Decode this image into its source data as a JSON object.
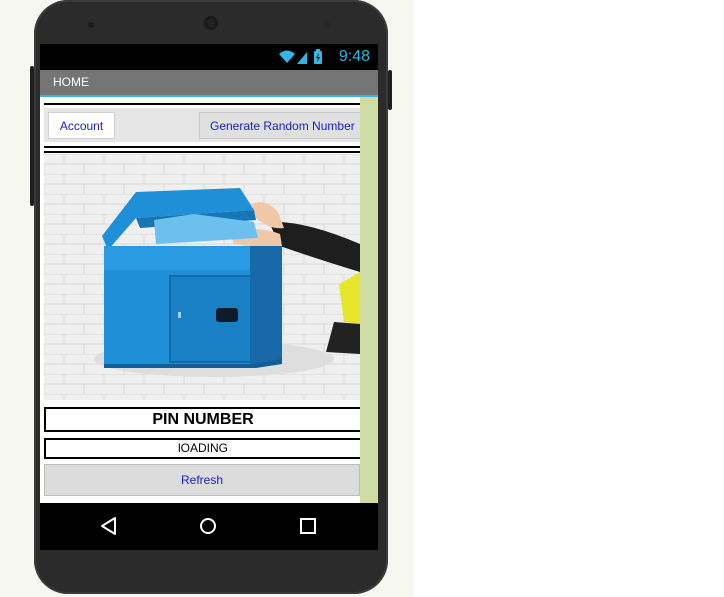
{
  "status_bar": {
    "time": "9:48",
    "icons": [
      "wifi-icon",
      "signal-icon",
      "battery-charging-icon"
    ],
    "color": "#33b5e5"
  },
  "title_bar": {
    "title": "HOME",
    "background": "#757575"
  },
  "buttons": {
    "account_label": "Account",
    "generate_label": "Generate Random Number",
    "refresh_label": "Refresh",
    "text_color": "#1a22c0"
  },
  "pin": {
    "heading": "PIN NUMBER",
    "value": "lOADING"
  },
  "image": {
    "subject": "blue parcel drop box being filled"
  },
  "nav_bar": {
    "icons": [
      "back-icon",
      "home-icon",
      "recents-icon"
    ]
  },
  "colors": {
    "scroll_track": "#cfdca3",
    "mailbox_blue": "#1f8fd8"
  }
}
